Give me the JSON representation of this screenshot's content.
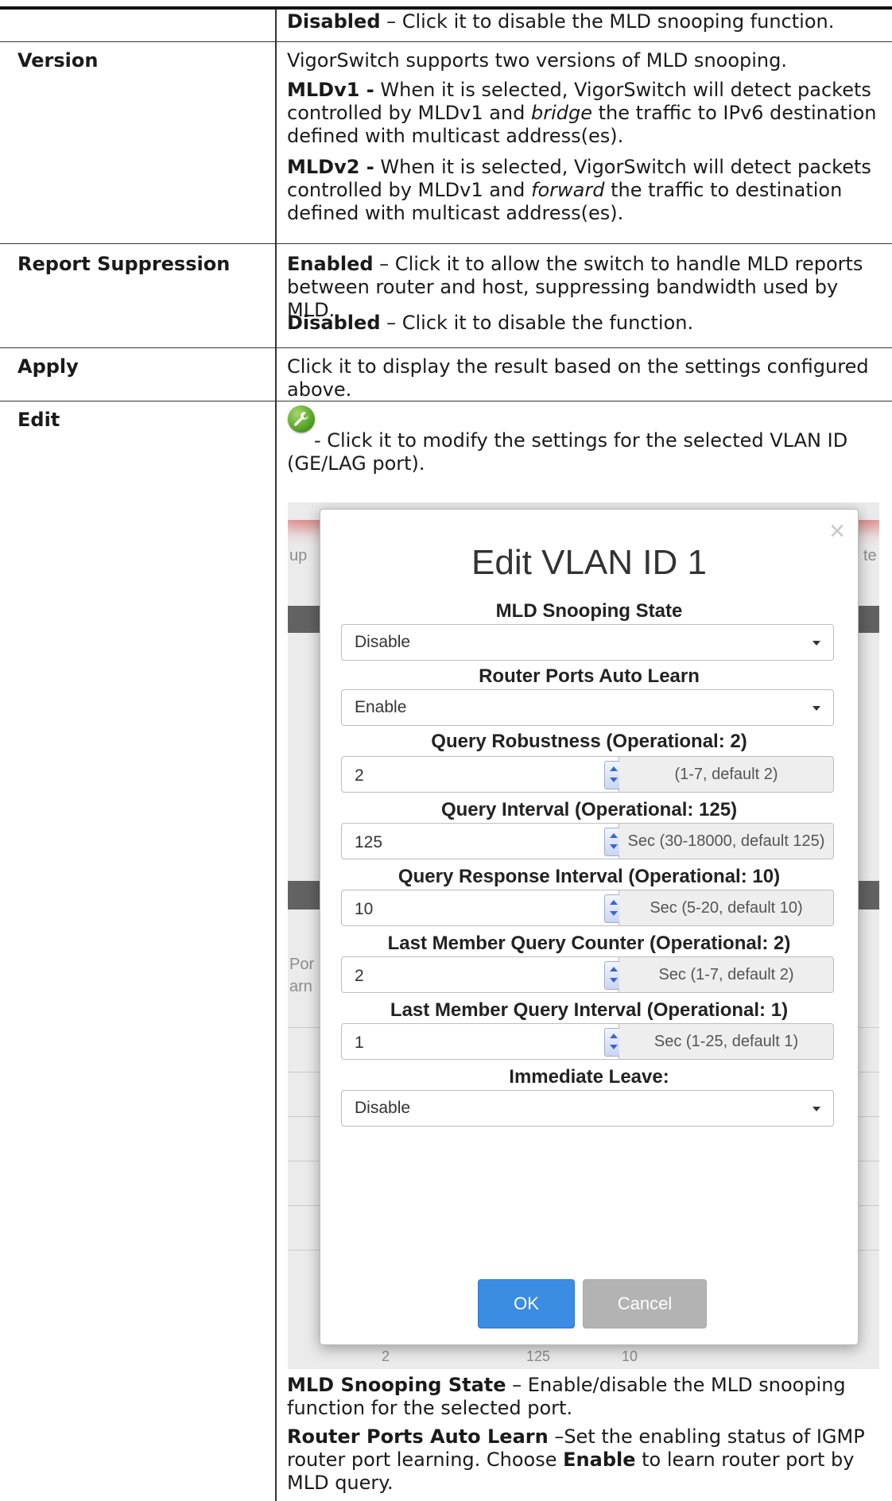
{
  "rows": {
    "version": {
      "label": "Version",
      "intro": "VigorSwitch supports two versions of MLD snooping.",
      "v1_term": "MLDv1 -",
      "v1_a": " When it is selected, VigorSwitch will detect packets controlled by MLDv1 and ",
      "v1_em": "bridge",
      "v1_b": " the traffic to IPv6 destination defined with multicast address(es).",
      "v2_term": "MLDv2 -",
      "v2_a": " When it is selected, VigorSwitch will detect packets controlled by MLDv1 and ",
      "v2_em": "forward",
      "v2_b": " the traffic to destination defined with multicast address(es)."
    },
    "top_disabled": {
      "term": "Disabled",
      "desc": " – Click it to disable the MLD snooping function."
    },
    "report": {
      "label": "Report Suppression",
      "en_term": "Enabled",
      "en_desc": " – Click it to allow the switch to handle MLD reports between router and host, suppressing bandwidth used by MLD.",
      "dis_term": "Disabled",
      "dis_desc": " – Click it to disable the function."
    },
    "apply": {
      "label": "Apply",
      "desc": "Click it to display the result based on the settings configured above."
    },
    "edit": {
      "label": "Edit",
      "icon_desc": "- Click it to modify the settings for the selected VLAN ID (GE/LAG port).",
      "state_term": "MLD Snooping State",
      "state_desc": " – Enable/disable the MLD snooping function for the selected port.",
      "router_term": "Router Ports Auto Learn",
      "router_desc_a": " –Set the enabling status of IGMP router port learning. Choose ",
      "router_enable": "Enable",
      "router_desc_b": " to learn router port by MLD query."
    }
  },
  "background": {
    "frag_left": "up",
    "frag_right": "te",
    "frag_por": "Por",
    "frag_arn": "arn",
    "bottom_a": "2",
    "bottom_b": "125",
    "bottom_c": "10"
  },
  "modal": {
    "title": "Edit VLAN ID 1",
    "close": "×",
    "snooping_label": "MLD Snooping State",
    "snooping_value": "Disable",
    "router_label": "Router Ports Auto Learn",
    "router_value": "Enable",
    "robust_label": "Query Robustness (Operational: 2)",
    "robust_value": "2",
    "robust_hint": "(1-7, default 2)",
    "qint_label": "Query Interval (Operational: 125)",
    "qint_value": "125",
    "qint_hint": "Sec (30-18000, default 125)",
    "qresp_label": "Query Response Interval (Operational: 10)",
    "qresp_value": "10",
    "qresp_hint": "Sec (5-20, default 10)",
    "lmqc_label": "Last Member Query Counter (Operational: 2)",
    "lmqc_value": "2",
    "lmqc_hint": "Sec (1-7, default 2)",
    "lmqi_label": "Last Member Query Interval (Operational: 1)",
    "lmqi_value": "1",
    "lmqi_hint": "Sec (1-25, default 1)",
    "leave_label": "Immediate Leave:",
    "leave_value": "Disable",
    "ok": "OK",
    "cancel": "Cancel"
  }
}
